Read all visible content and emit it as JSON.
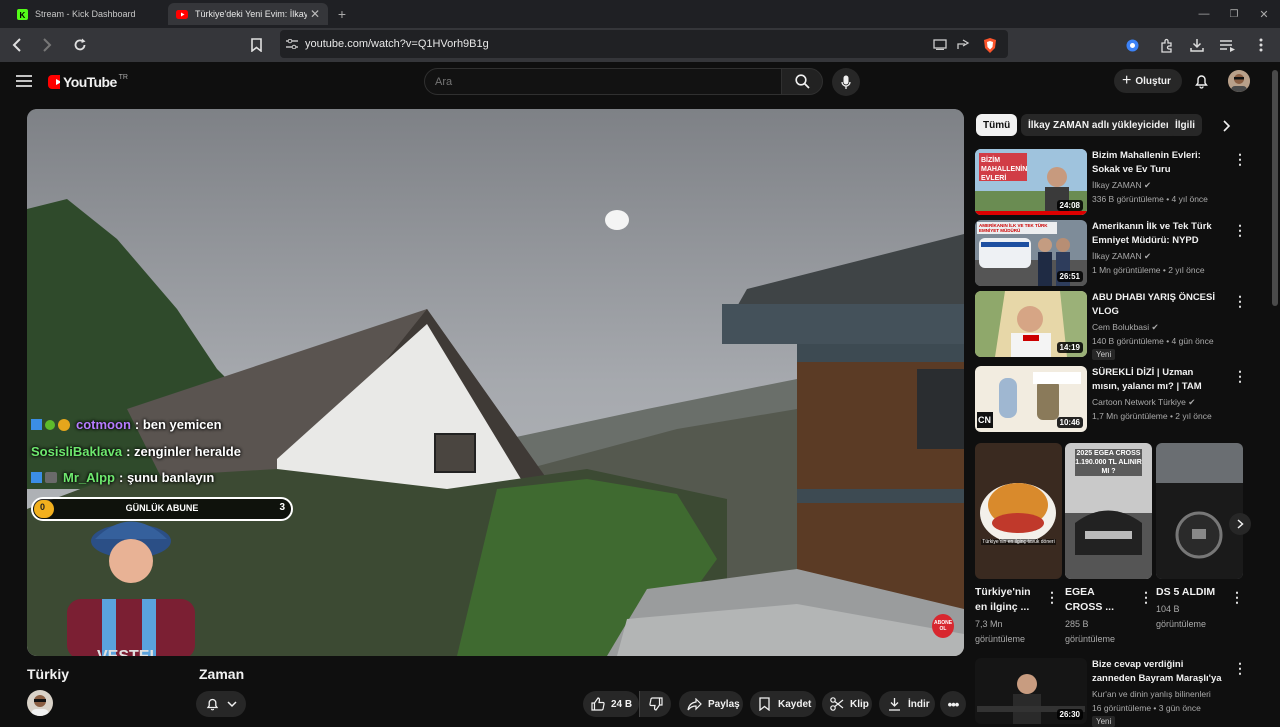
{
  "browser": {
    "tabs": [
      {
        "title": "Stream - Kick Dashboard"
      },
      {
        "title": "Türkiye'deki Yeni Evim: İlkay Zaman"
      }
    ],
    "url": "youtube.com/watch?v=Q1HVorh9B1g"
  },
  "header": {
    "logo_text": "YouTube",
    "region": "TR",
    "search_placeholder": "Ara",
    "create_label": "Oluştur"
  },
  "overlay": {
    "chat": [
      {
        "user": "cotmoon",
        "message": ": ben yemicen",
        "color": "#b77cff"
      },
      {
        "user": "SosisliBaklava",
        "message": ": zenginler heralde",
        "color": "#6ee86e"
      },
      {
        "user": "Mr_Alpp",
        "message": ": şunu banlayın",
        "color": "#6ee86e"
      }
    ],
    "subs_bar": {
      "left": "0",
      "label": "GÜNLÜK ABUNE",
      "right": "3",
      "progress": 0.04
    },
    "abone_label": "ABONE OL"
  },
  "video": {
    "title_left": "Türkiy",
    "title_right": "Zaman"
  },
  "actions": {
    "likes": "24 B",
    "share": "Paylaş",
    "save": "Kaydet",
    "clip": "Klip",
    "download": "İndir"
  },
  "sidebar": {
    "chips": [
      "Tümü",
      "İlkay ZAMAN adlı yükleyiciden",
      "İlgili"
    ],
    "recommendations": [
      {
        "title": "Bizim Mahallenin Evleri: Sokak ve Ev Turu",
        "channel": "İlkay ZAMAN",
        "meta": "336 B görüntüleme • 4 yıl önce",
        "duration": "24:08",
        "thumb_text": "BİZİM MAHALLENİN EVLERİ"
      },
      {
        "title": "Amerikanın İlk ve Tek Türk Emniyet Müdürü: NYPD",
        "channel": "İlkay ZAMAN",
        "meta": "1 Mn görüntüleme • 2 yıl önce",
        "duration": "26:51",
        "thumb_text": "AMERİKANIN İLK VE TEK TÜRK EMNİYET MÜDÜRÜ"
      },
      {
        "title": "ABU DHABI YARIŞ ÖNCESİ VLOG",
        "channel": "Cem Bolukbasi",
        "meta": "140 B görüntüleme • 4 gün önce",
        "duration": "14:19",
        "badge": "Yeni"
      },
      {
        "title": "SÜREKLİ DİZİ | Uzman mısın, yalancı mı? | TAM BÖLÜM | ...",
        "channel": "Cartoon Network Türkiye",
        "meta": "1,7 Mn görüntüleme • 2 yıl önce",
        "duration": "10:46",
        "thumb_text": "CN"
      }
    ],
    "shorts": [
      {
        "title": "Türkiye'nin en ilginç ...",
        "views": "7,3 Mn görüntüleme",
        "thumb_text": "Türkiye'nin en ilginç tavuk döneri"
      },
      {
        "title": "EGEA CROSS ...",
        "views": "285 B görüntüleme",
        "thumb_text": "2025 EGEA CROSS 1.190.000 TL ALINIR MI ?"
      },
      {
        "title": "DS 5 ALDIM",
        "views": "104 B görüntüleme"
      }
    ],
    "bottom_rec": {
      "title": "Bize cevap verdiğini zanneden Bayram Maraşlı'ya reddiye",
      "channel": "Kur'an ve dinin yanlış bilinenleri",
      "meta": "16 görüntüleme • 3 gün önce",
      "duration": "26:30",
      "badge": "Yeni"
    }
  },
  "colors": {
    "accent": "#ff0000",
    "chip_bg": "#272727",
    "background": "#0f0f0f"
  }
}
